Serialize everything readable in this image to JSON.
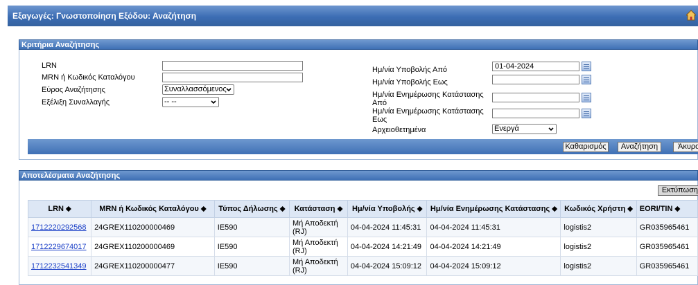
{
  "window": {
    "title": "Εξαγωγές: Γνωστοποίηση Εξόδου: Αναζήτηση"
  },
  "criteria": {
    "header": "Κριτήρια Αναζήτησης",
    "lrn_label": "LRN",
    "lrn_value": "",
    "mrn_label": "MRN ή Κωδικός Καταλόγου",
    "mrn_value": "",
    "scope_label": "Εύρος Αναζήτησης",
    "scope_value": "Συναλλασσόμενος",
    "status_label": "Εξέλιξη Συναλλαγής",
    "status_value": "-- --",
    "submit_from_label": "Ημ/νία Υποβολής Από",
    "submit_from_value": "01-04-2024",
    "submit_to_label": "Ημ/νία Υποβολής Εως",
    "submit_to_value": "",
    "update_from_label": "Ημ/νία Ενημέρωσης Κατάστασης Από",
    "update_from_value": "",
    "update_to_label": "Ημ/νία Ενημέρωσης Κατάστασης Εως",
    "update_to_value": "",
    "archived_label": "Αρχειοθετημένα",
    "archived_value": "Ενεργά"
  },
  "buttons": {
    "clear": "Καθαρισμός",
    "search": "Αναζήτηση",
    "cancel": "Άκυρο"
  },
  "results": {
    "header": "Αποτελέσματα Αναζήτησης",
    "print": "Εκτύπωση",
    "columns": [
      "LRN ⬥",
      "MRN ή Κωδικός Καταλόγου ⬥",
      "Τύπος Δήλωσης ⬥",
      "Κατάσταση ⬥",
      "Ημ/νία Υποβολής ⬥",
      "Ημ/νία Ενημέρωσης Κατάστασης ⬥",
      "Κωδικός Χρήστη ⬥",
      "EORI/TIN ⬥"
    ],
    "rows": [
      [
        "1712220292568",
        "24GREX110200000469",
        "IE590",
        "Μή Αποδεκτή (RJ)",
        "04-04-2024 11:45:31",
        "04-04-2024 11:45:31",
        "logistis2",
        "GR035965461"
      ],
      [
        "1712229674017",
        "24GREX110200000469",
        "IE590",
        "Μή Αποδεκτή (RJ)",
        "04-04-2024 14:21:49",
        "04-04-2024 14:21:49",
        "logistis2",
        "GR035965461"
      ],
      [
        "1712232541349",
        "24GREX110200000477",
        "IE590",
        "Μή Αποδεκτή (RJ)",
        "04-04-2024 15:09:12",
        "04-04-2024 15:09:12",
        "logistis2",
        "GR035965461"
      ]
    ]
  }
}
